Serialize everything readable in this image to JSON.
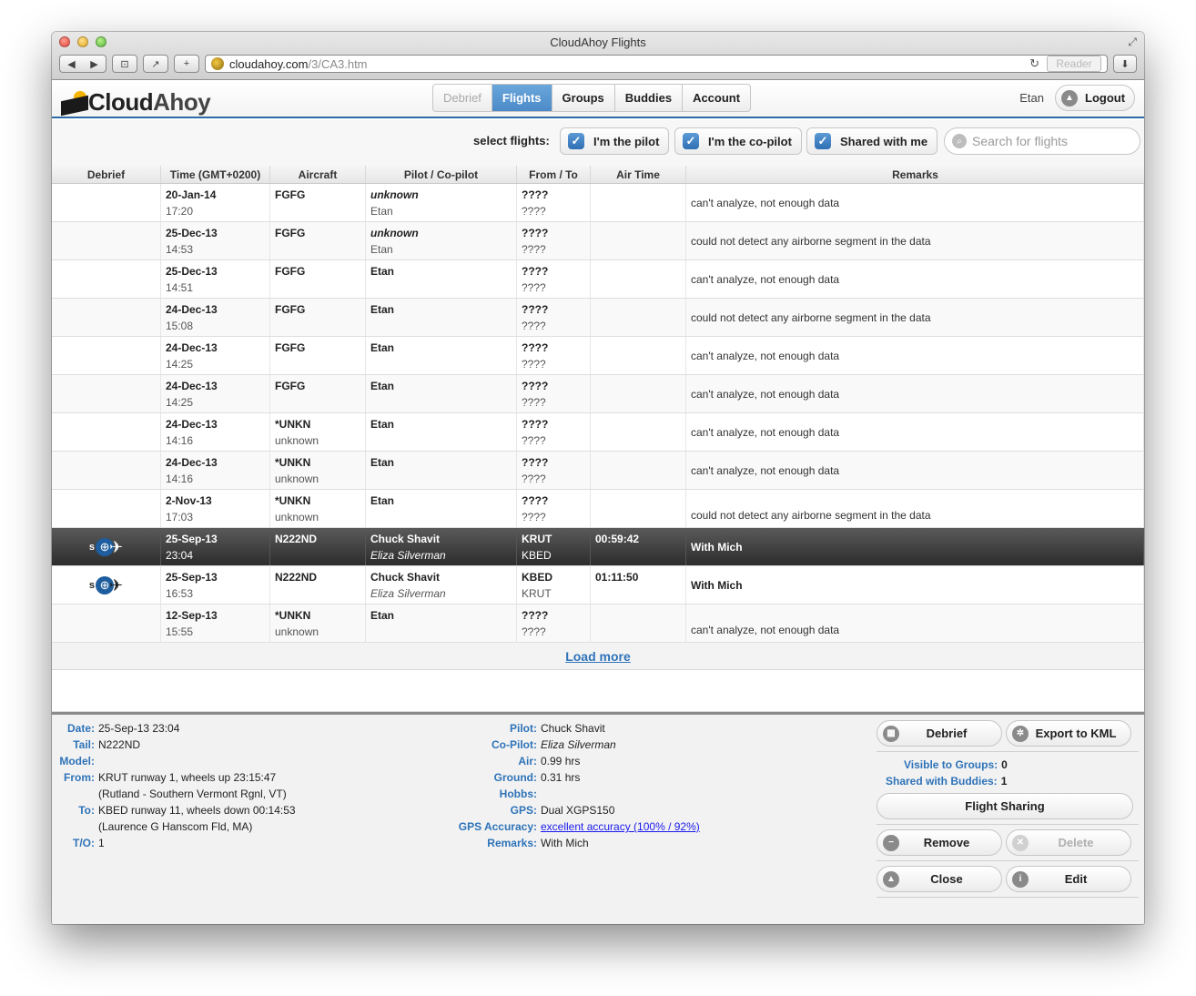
{
  "window": {
    "title": "CloudAhoy Flights",
    "url_host": "cloudahoy.com",
    "url_path": "/3/CA3.htm",
    "reader_label": "Reader"
  },
  "app": {
    "logo_cloud": "Cloud",
    "logo_ahoy": "Ahoy",
    "tabs": [
      {
        "label": "Debrief"
      },
      {
        "label": "Flights"
      },
      {
        "label": "Groups"
      },
      {
        "label": "Buddies"
      },
      {
        "label": "Account"
      }
    ],
    "user_name": "Etan",
    "logout_label": "Logout"
  },
  "filters": {
    "label": "select flights:",
    "pilot": "I'm the pilot",
    "copilot": "I'm the co-pilot",
    "shared": "Shared with me",
    "search_placeholder": "Search for flights"
  },
  "table": {
    "headers": [
      "Debrief",
      "Time (GMT+0200)",
      "Aircraft",
      "Pilot / Co-pilot",
      "From / To",
      "Air Time",
      "Remarks"
    ],
    "rows": [
      {
        "date": "20-Jan-14",
        "time": "17:20",
        "aircraft": "FGFG",
        "aircraft_sub": "",
        "pilot": "unknown",
        "copilot": "Etan",
        "from": "????",
        "to": "????",
        "air": "",
        "remarks": "can't analyze, not enough data"
      },
      {
        "date": "25-Dec-13",
        "time": "14:53",
        "aircraft": "FGFG",
        "aircraft_sub": "",
        "pilot": "unknown",
        "copilot": "Etan",
        "from": "????",
        "to": "????",
        "air": "",
        "remarks": "could not detect any airborne segment in the data"
      },
      {
        "date": "25-Dec-13",
        "time": "14:51",
        "aircraft": "FGFG",
        "aircraft_sub": "",
        "pilot": "Etan",
        "copilot": "",
        "from": "????",
        "to": "????",
        "air": "",
        "remarks": "can't analyze, not enough data"
      },
      {
        "date": "24-Dec-13",
        "time": "15:08",
        "aircraft": "FGFG",
        "aircraft_sub": "",
        "pilot": "Etan",
        "copilot": "",
        "from": "????",
        "to": "????",
        "air": "",
        "remarks": "could not detect any airborne segment in the data"
      },
      {
        "date": "24-Dec-13",
        "time": "14:25",
        "aircraft": "FGFG",
        "aircraft_sub": "",
        "pilot": "Etan",
        "copilot": "",
        "from": "????",
        "to": "????",
        "air": "",
        "remarks": "can't analyze, not enough data"
      },
      {
        "date": "24-Dec-13",
        "time": "14:25",
        "aircraft": "FGFG",
        "aircraft_sub": "",
        "pilot": "Etan",
        "copilot": "",
        "from": "????",
        "to": "????",
        "air": "",
        "remarks": "can't analyze, not enough data"
      },
      {
        "date": "24-Dec-13",
        "time": "14:16",
        "aircraft": "*UNKN",
        "aircraft_sub": "unknown",
        "pilot": "Etan",
        "copilot": "",
        "from": "????",
        "to": "????",
        "air": "",
        "remarks": "can't analyze, not enough data"
      },
      {
        "date": "24-Dec-13",
        "time": "14:16",
        "aircraft": "*UNKN",
        "aircraft_sub": "unknown",
        "pilot": "Etan",
        "copilot": "",
        "from": "????",
        "to": "????",
        "air": "",
        "remarks": "can't analyze, not enough data"
      },
      {
        "date": "2-Nov-13",
        "time": "17:03",
        "aircraft": "*UNKN",
        "aircraft_sub": "unknown",
        "pilot": "Etan",
        "copilot": "",
        "from": "????",
        "to": "????",
        "air": "",
        "remarks": "could not detect any airborne segment in the data"
      },
      {
        "date": "25-Sep-13",
        "time": "23:04",
        "aircraft": "N222ND",
        "aircraft_sub": "",
        "pilot": "Chuck Shavit",
        "copilot": "Eliza Silverman",
        "from": "KRUT",
        "to": "KBED",
        "air": "00:59:42",
        "remarks": "With Mich",
        "debrief_letter": "s"
      },
      {
        "date": "25-Sep-13",
        "time": "16:53",
        "aircraft": "N222ND",
        "aircraft_sub": "",
        "pilot": "Chuck Shavit",
        "copilot": "Eliza Silverman",
        "from": "KBED",
        "to": "KRUT",
        "air": "01:11:50",
        "remarks": "With Mich",
        "debrief_letter": "s"
      },
      {
        "date": "12-Sep-13",
        "time": "15:55",
        "aircraft": "*UNKN",
        "aircraft_sub": "unknown",
        "pilot": "Etan",
        "copilot": "",
        "from": "????",
        "to": "????",
        "air": "",
        "remarks": "can't analyze, not enough data"
      }
    ],
    "load_more": "Load more"
  },
  "details": {
    "left": [
      {
        "label": "Date:",
        "value": "25-Sep-13 23:04"
      },
      {
        "label": "Tail:",
        "value": "N222ND"
      },
      {
        "label": "Model:",
        "value": ""
      },
      {
        "label": "From:",
        "value": "KRUT runway 1, wheels up 23:15:47"
      },
      {
        "label": "",
        "value": "(Rutland - Southern Vermont Rgnl, VT)"
      },
      {
        "label": "To:",
        "value": "KBED runway 11, wheels down 00:14:53"
      },
      {
        "label": "",
        "value": "(Laurence G Hanscom Fld, MA)"
      },
      {
        "label": "T/O:",
        "value": "1"
      }
    ],
    "mid": [
      {
        "label": "Pilot:",
        "value": "Chuck Shavit"
      },
      {
        "label": "Co-Pilot:",
        "value": "Eliza Silverman"
      },
      {
        "label": "Air:",
        "value": "0.99 hrs"
      },
      {
        "label": "Ground:",
        "value": "0.31 hrs"
      },
      {
        "label": "Hobbs:",
        "value": ""
      },
      {
        "label": "GPS:",
        "value": "Dual XGPS150"
      },
      {
        "label": "GPS Accuracy:",
        "value": "excellent accuracy (100% / 92%)"
      },
      {
        "label": "Remarks:",
        "value": "With Mich"
      }
    ],
    "actions": {
      "debrief": "Debrief",
      "export": "Export to KML",
      "visible_groups_label": "Visible to Groups:",
      "visible_groups_value": "0",
      "shared_buddies_label": "Shared with Buddies:",
      "shared_buddies_value": "1",
      "flight_sharing": "Flight Sharing",
      "remove": "Remove",
      "delete": "Delete",
      "close": "Close",
      "edit": "Edit"
    }
  },
  "colors": {
    "accent": "#2e73b8",
    "active_tab": "#4c8bc9",
    "selected_row": "#2c2c2c"
  }
}
